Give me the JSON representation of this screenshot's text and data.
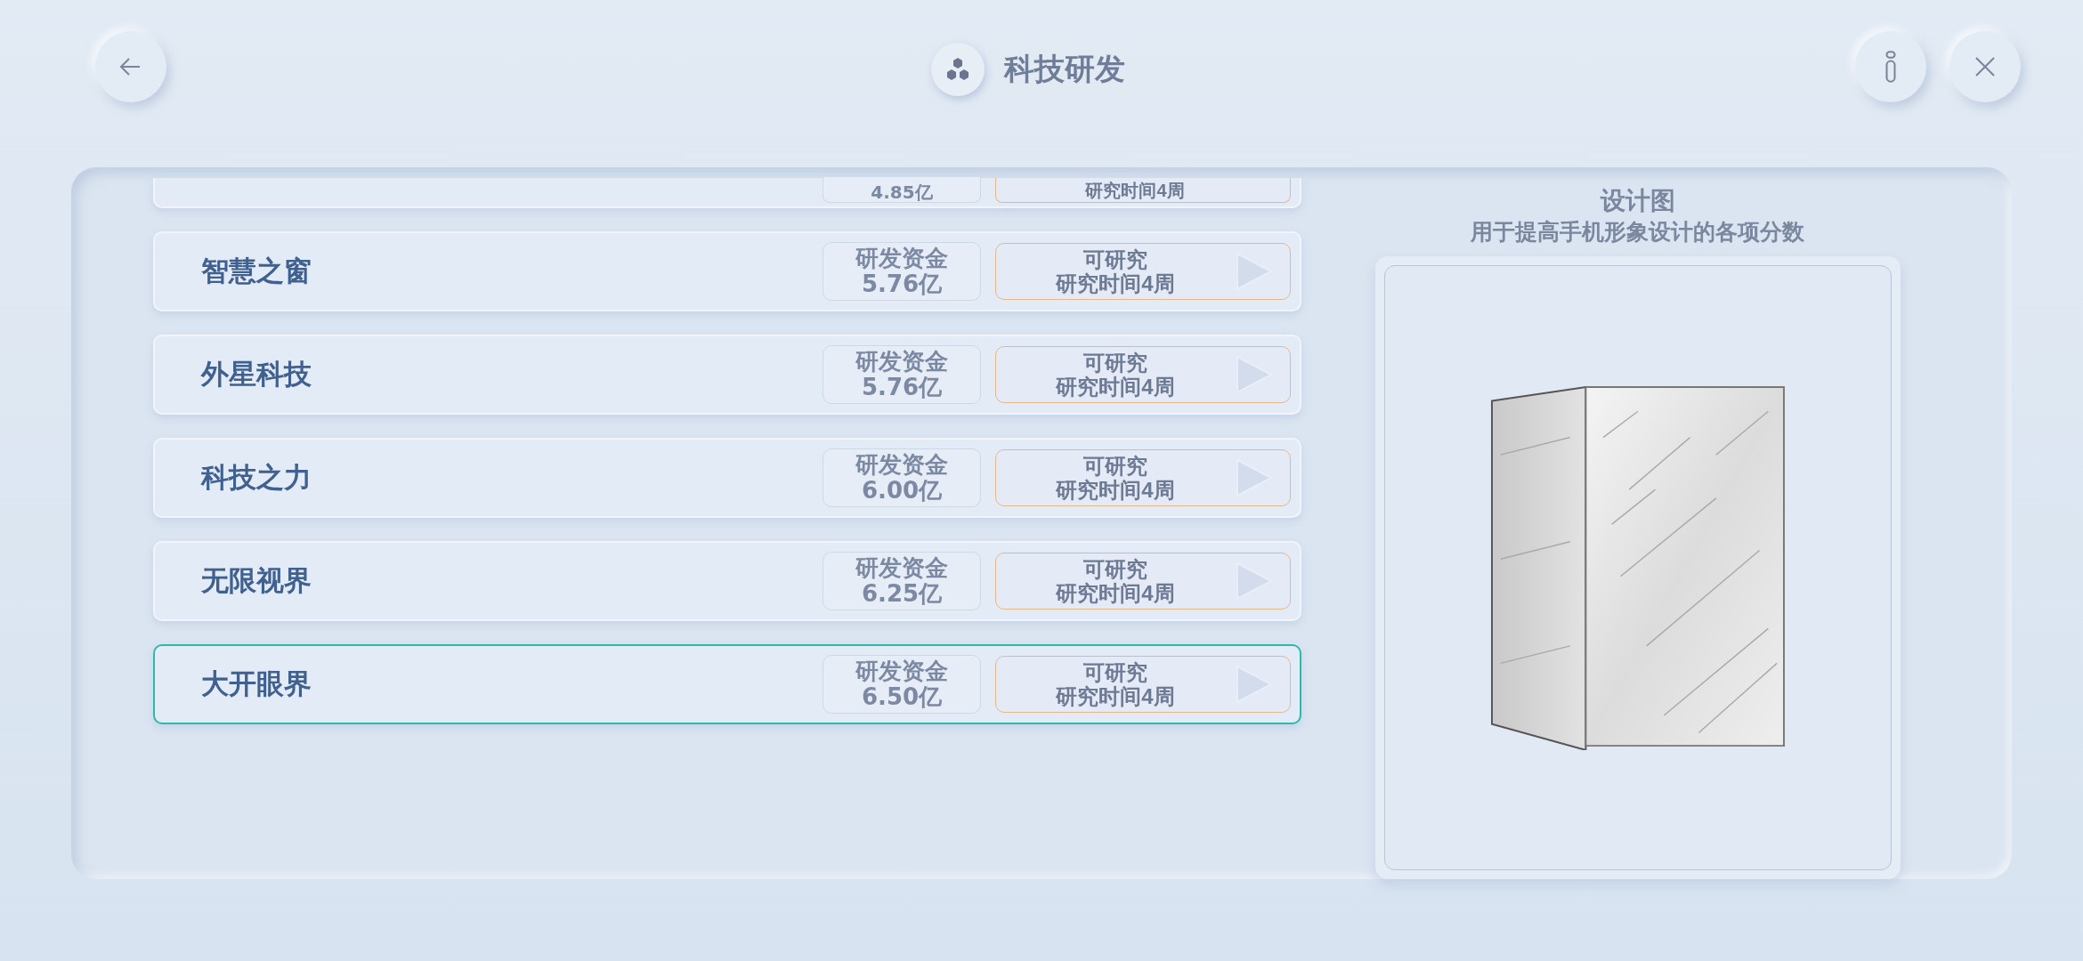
{
  "header": {
    "title": "科技研发"
  },
  "research": [
    {
      "kind": "partial",
      "funding": "4.85亿",
      "time": "研究时间4周",
      "selected": false
    },
    {
      "kind": "full",
      "name": "智慧之窗",
      "funding_label": "研发资金",
      "funding": "5.76亿",
      "status": "可研究",
      "time": "研究时间4周",
      "selected": false
    },
    {
      "kind": "full",
      "name": "外星科技",
      "funding_label": "研发资金",
      "funding": "5.76亿",
      "status": "可研究",
      "time": "研究时间4周",
      "selected": false
    },
    {
      "kind": "full",
      "name": "科技之力",
      "funding_label": "研发资金",
      "funding": "6.00亿",
      "status": "可研究",
      "time": "研究时间4周",
      "selected": false
    },
    {
      "kind": "full",
      "name": "无限视界",
      "funding_label": "研发资金",
      "funding": "6.25亿",
      "status": "可研究",
      "time": "研究时间4周",
      "selected": false
    },
    {
      "kind": "full",
      "name": "大开眼界",
      "funding_label": "研发资金",
      "funding": "6.50亿",
      "status": "可研究",
      "time": "研究时间4周",
      "selected": true
    }
  ],
  "preview": {
    "title": "设计图",
    "description": "用于提高手机形象设计的各项分数"
  }
}
